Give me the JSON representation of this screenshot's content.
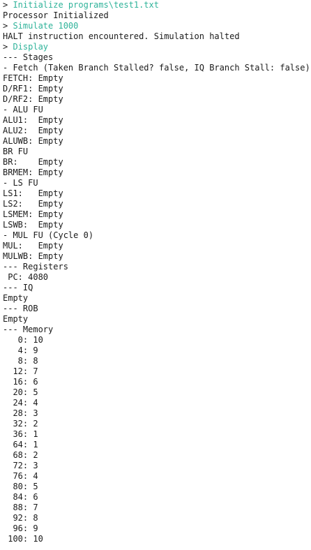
{
  "colors": {
    "command": "#2fb39a",
    "text": "#1a1a1a",
    "background": "#ffffff"
  },
  "lines": [
    {
      "prompt": "> ",
      "text": "Initialize programs\\test1.txt",
      "kind": "command"
    },
    {
      "text": "Processor Initialized",
      "kind": "output"
    },
    {
      "prompt": "> ",
      "text": "Simulate 1000",
      "kind": "command"
    },
    {
      "text": "HALT instruction encountered. Simulation halted",
      "kind": "output"
    },
    {
      "prompt": "> ",
      "text": "Display",
      "kind": "command"
    },
    {
      "text": "--- Stages",
      "kind": "output"
    },
    {
      "text": "- Fetch (Taken Branch Stalled? false, IQ Branch Stall: false)",
      "kind": "output"
    },
    {
      "text": "FETCH: Empty",
      "kind": "output"
    },
    {
      "text": "D/RF1: Empty",
      "kind": "output"
    },
    {
      "text": "D/RF2: Empty",
      "kind": "output"
    },
    {
      "text": "- ALU FU",
      "kind": "output"
    },
    {
      "text": "ALU1:  Empty",
      "kind": "output"
    },
    {
      "text": "ALU2:  Empty",
      "kind": "output"
    },
    {
      "text": "ALUWB: Empty",
      "kind": "output"
    },
    {
      "text": "BR FU",
      "kind": "output"
    },
    {
      "text": "BR:    Empty",
      "kind": "output"
    },
    {
      "text": "BRMEM: Empty",
      "kind": "output"
    },
    {
      "text": "- LS FU",
      "kind": "output"
    },
    {
      "text": "LS1:   Empty",
      "kind": "output"
    },
    {
      "text": "LS2:   Empty",
      "kind": "output"
    },
    {
      "text": "LSMEM: Empty",
      "kind": "output"
    },
    {
      "text": "LSWB:  Empty",
      "kind": "output"
    },
    {
      "text": "- MUL FU (Cycle 0)",
      "kind": "output"
    },
    {
      "text": "MUL:   Empty",
      "kind": "output"
    },
    {
      "text": "MULWB: Empty",
      "kind": "output"
    },
    {
      "text": "--- Registers",
      "kind": "output"
    },
    {
      "text": " PC: 4080",
      "kind": "output"
    },
    {
      "text": "--- IQ",
      "kind": "output"
    },
    {
      "text": "Empty",
      "kind": "output"
    },
    {
      "text": "--- ROB",
      "kind": "output"
    },
    {
      "text": "Empty",
      "kind": "output"
    },
    {
      "text": "--- Memory",
      "kind": "output"
    },
    {
      "text": "   0: 10",
      "kind": "output"
    },
    {
      "text": "   4: 9",
      "kind": "output"
    },
    {
      "text": "   8: 8",
      "kind": "output"
    },
    {
      "text": "  12: 7",
      "kind": "output"
    },
    {
      "text": "  16: 6",
      "kind": "output"
    },
    {
      "text": "  20: 5",
      "kind": "output"
    },
    {
      "text": "  24: 4",
      "kind": "output"
    },
    {
      "text": "  28: 3",
      "kind": "output"
    },
    {
      "text": "  32: 2",
      "kind": "output"
    },
    {
      "text": "  36: 1",
      "kind": "output"
    },
    {
      "text": "  64: 1",
      "kind": "output"
    },
    {
      "text": "  68: 2",
      "kind": "output"
    },
    {
      "text": "  72: 3",
      "kind": "output"
    },
    {
      "text": "  76: 4",
      "kind": "output"
    },
    {
      "text": "  80: 5",
      "kind": "output"
    },
    {
      "text": "  84: 6",
      "kind": "output"
    },
    {
      "text": "  88: 7",
      "kind": "output"
    },
    {
      "text": "  92: 8",
      "kind": "output"
    },
    {
      "text": "  96: 9",
      "kind": "output"
    },
    {
      "text": " 100: 10",
      "kind": "output"
    }
  ]
}
